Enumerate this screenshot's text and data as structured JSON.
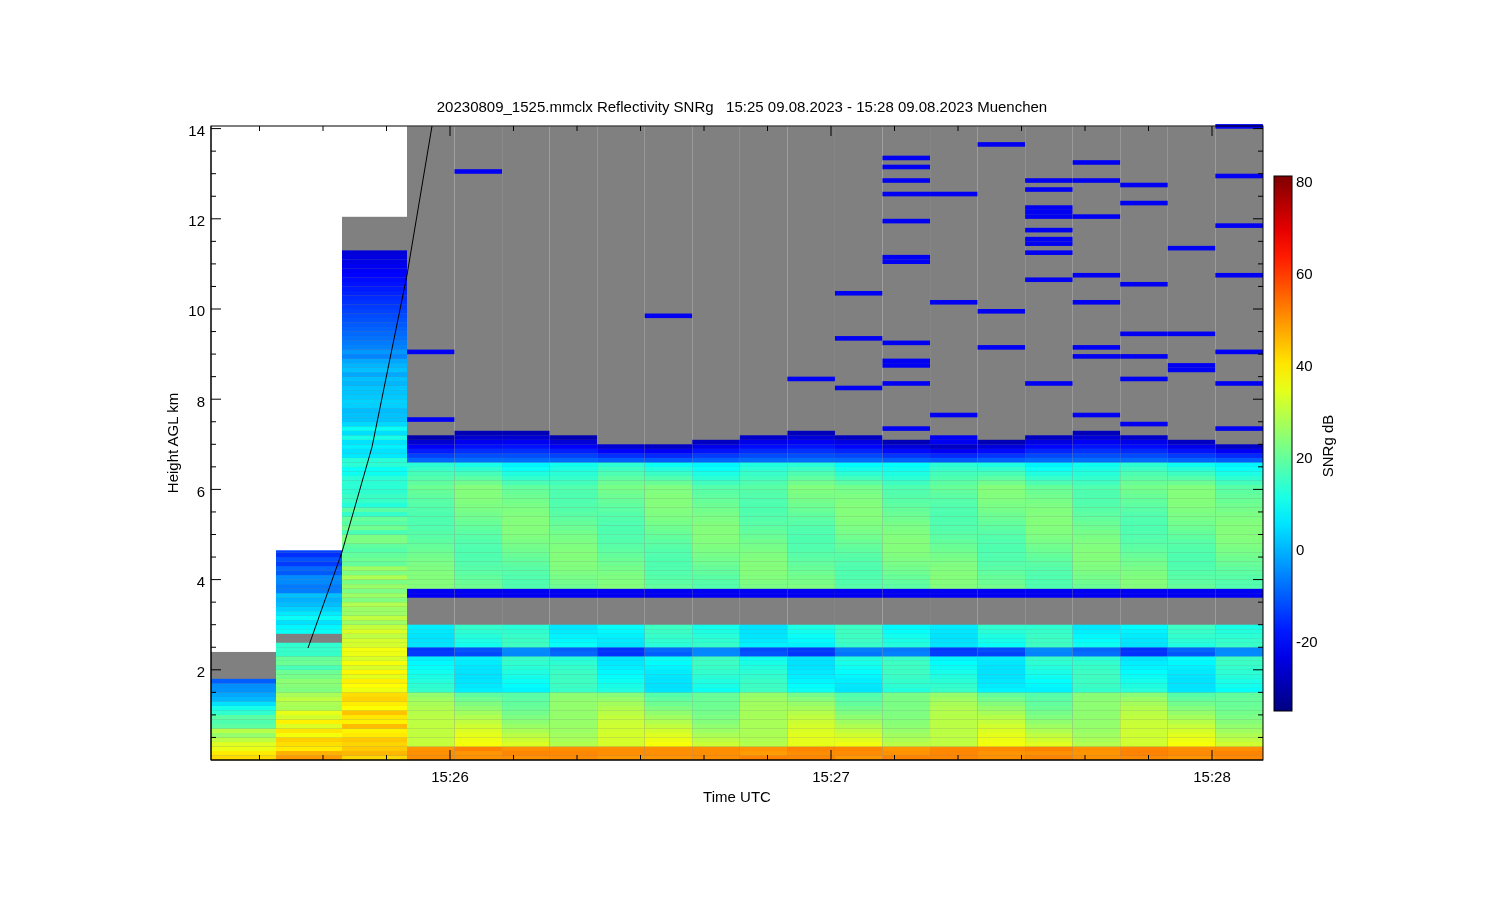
{
  "title": "20230809_1525.mmclx Reflectivity SNRg   15:25 09.08.2023 - 15:28 09.08.2023 Muenchen",
  "y_axis": {
    "label": "Height AGL km",
    "ticks": [
      "14",
      "12",
      "10",
      "8",
      "6",
      "4",
      "2"
    ]
  },
  "x_axis": {
    "label": "Time UTC",
    "ticks": [
      "15:26",
      "15:27",
      "15:28"
    ]
  },
  "colorbar": {
    "label": "SNRg dB",
    "ticks": [
      "80",
      "60",
      "40",
      "20",
      "0",
      "-20"
    ]
  }
}
